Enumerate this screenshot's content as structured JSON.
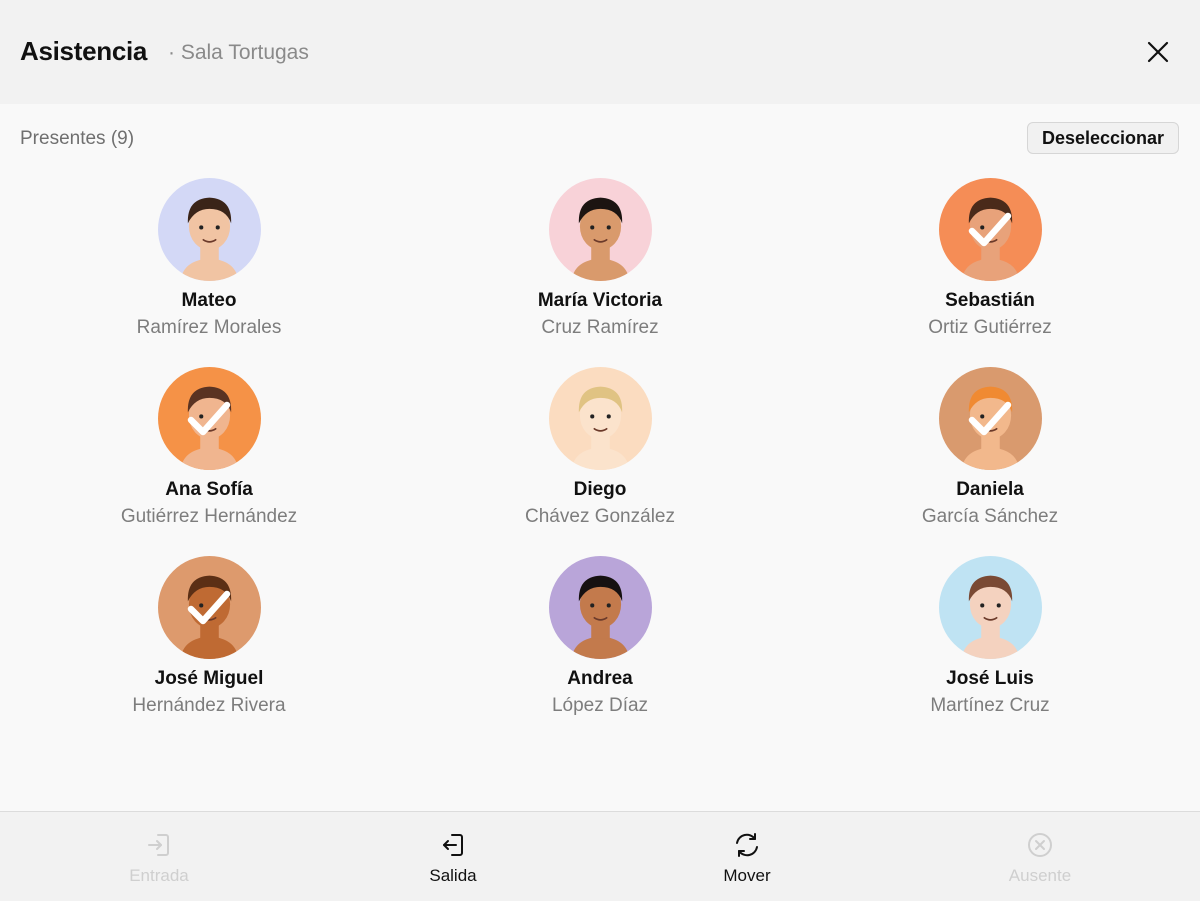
{
  "header": {
    "title": "Asistencia",
    "subtitle": "· Sala Tortugas"
  },
  "section": {
    "label": "Presentes (9)",
    "deselect_label": "Deseleccionar"
  },
  "students": [
    {
      "first_name": "Mateo",
      "last_name": "Ramírez Morales",
      "selected": false,
      "bg": "#d3d8f6",
      "skin": "#f1c4a3",
      "hair": "#3a2418"
    },
    {
      "first_name": "María Victoria",
      "last_name": "Cruz Ramírez",
      "selected": false,
      "bg": "#f8d2d8",
      "skin": "#d99a6c",
      "hair": "#1c1411"
    },
    {
      "first_name": "Sebastián",
      "last_name": "Ortiz Gutiérrez",
      "selected": true,
      "bg": "#f58d56",
      "skin": "#e8a27a",
      "hair": "#4a2a1a"
    },
    {
      "first_name": "Ana Sofía",
      "last_name": "Gutiérrez Hernández",
      "selected": true,
      "bg": "#f59247",
      "skin": "#f0b58f",
      "hair": "#5a3322"
    },
    {
      "first_name": "Diego",
      "last_name": "Chávez González",
      "selected": false,
      "bg": "#fbdcc0",
      "skin": "#fbe3cc",
      "hair": "#e0c383"
    },
    {
      "first_name": "Daniela",
      "last_name": "García Sánchez",
      "selected": true,
      "bg": "#d99a6e",
      "skin": "#f2b88c",
      "hair": "#f08a32"
    },
    {
      "first_name": "José Miguel",
      "last_name": "Hernández Rivera",
      "selected": true,
      "bg": "#dd9a6d",
      "skin": "#bf6a33",
      "hair": "#5b2f15"
    },
    {
      "first_name": "Andrea",
      "last_name": "López Díaz",
      "selected": false,
      "bg": "#b9a5d9",
      "skin": "#c37a4c",
      "hair": "#161111"
    },
    {
      "first_name": "José Luis",
      "last_name": "Martínez Cruz",
      "selected": false,
      "bg": "#bfe3f3",
      "skin": "#f4d2bf",
      "hair": "#7a4a34"
    }
  ],
  "actions": [
    {
      "label": "Entrada",
      "icon": "entrada-icon",
      "enabled": false
    },
    {
      "label": "Salida",
      "icon": "salida-icon",
      "enabled": true
    },
    {
      "label": "Mover",
      "icon": "mover-icon",
      "enabled": true
    },
    {
      "label": "Ausente",
      "icon": "ausente-icon",
      "enabled": false
    }
  ],
  "colors": {
    "disabled": "#cfcfcf",
    "enabled": "#111111",
    "check": "#ffffff"
  }
}
